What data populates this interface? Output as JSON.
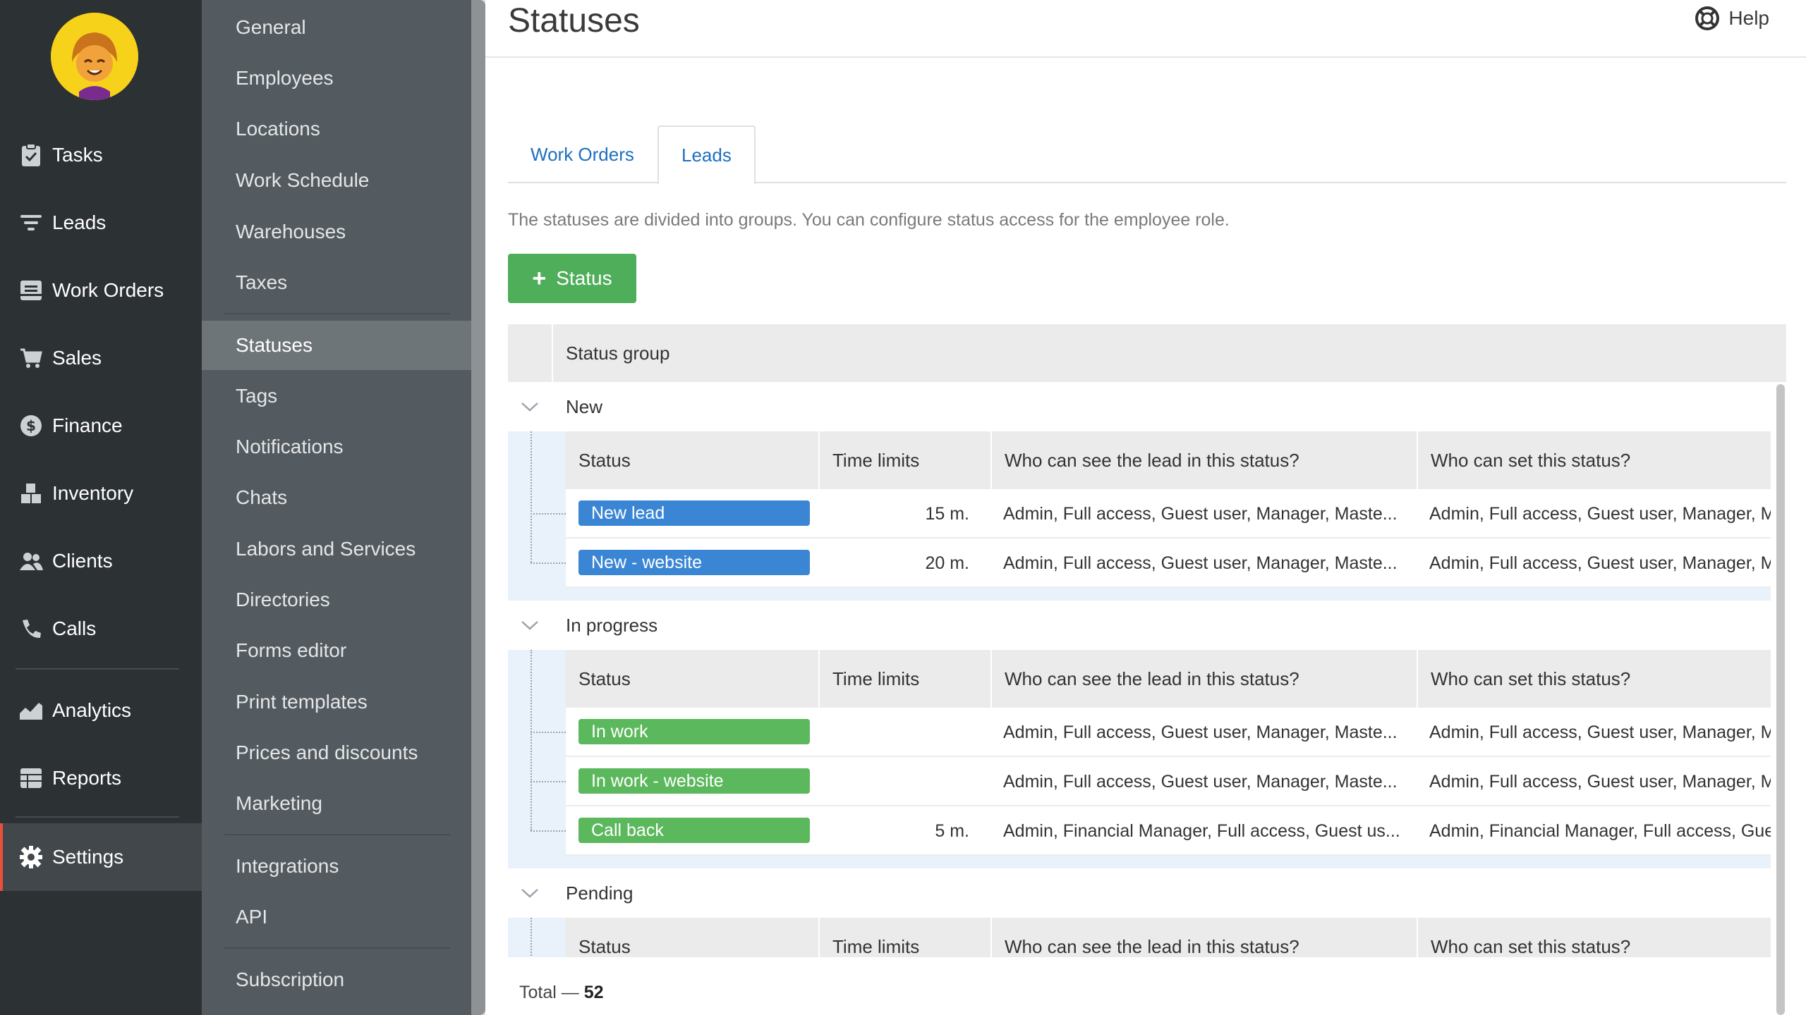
{
  "nav": {
    "items": [
      {
        "label": "Tasks",
        "icon": "clipboard-icon"
      },
      {
        "label": "Leads",
        "icon": "funnel-icon"
      },
      {
        "label": "Work Orders",
        "icon": "work-order-icon"
      },
      {
        "label": "Sales",
        "icon": "cart-icon"
      },
      {
        "label": "Finance",
        "icon": "dollar-icon"
      },
      {
        "label": "Inventory",
        "icon": "boxes-icon"
      },
      {
        "label": "Clients",
        "icon": "users-icon"
      },
      {
        "label": "Calls",
        "icon": "phone-icon"
      },
      {
        "label": "Analytics",
        "icon": "chart-icon"
      },
      {
        "label": "Reports",
        "icon": "report-icon"
      },
      {
        "label": "Settings",
        "icon": "gear-icon"
      }
    ]
  },
  "settings_menu": {
    "items": [
      "General",
      "Employees",
      "Locations",
      "Work Schedule",
      "Warehouses",
      "Taxes",
      "Statuses",
      "Tags",
      "Notifications",
      "Chats",
      "Labors and Services",
      "Directories",
      "Forms editor",
      "Print templates",
      "Prices and discounts",
      "Marketing",
      "Integrations",
      "API",
      "Subscription"
    ],
    "active": "Statuses"
  },
  "header": {
    "title": "Statuses",
    "help_label": "Help"
  },
  "tabs": [
    {
      "label": "Work Orders",
      "active": false
    },
    {
      "label": "Leads",
      "active": true
    }
  ],
  "description": "The statuses are divided into groups. You can configure status access for the employee role.",
  "add_button_label": "Status",
  "table": {
    "header": "Status group",
    "columns": [
      "Status",
      "Time limits",
      "Who can see the lead in this status?",
      "Who can set this status?"
    ],
    "groups": [
      {
        "name": "New",
        "statuses": [
          {
            "name": "New lead",
            "color": "#3b86d4",
            "time": "15 m.",
            "see": "Admin,  Full access,  Guest user,  Manager,  Maste...",
            "set": "Admin,  Full access,  Guest user,  Manager,  M"
          },
          {
            "name": "New - website",
            "color": "#3b86d4",
            "time": "20 m.",
            "see": "Admin,  Full access,  Guest user,  Manager,  Maste...",
            "set": "Admin,  Full access,  Guest user,  Manager,  M"
          }
        ]
      },
      {
        "name": "In progress",
        "statuses": [
          {
            "name": "In work",
            "color": "#5cb85c",
            "time": "",
            "see": "Admin,  Full access,  Guest user,  Manager,  Maste...",
            "set": "Admin,  Full access,  Guest user,  Manager,  M"
          },
          {
            "name": "In work - website",
            "color": "#5cb85c",
            "time": "",
            "see": "Admin,  Full access,  Guest user,  Manager,  Maste...",
            "set": "Admin,  Full access,  Guest user,  Manager,  M"
          },
          {
            "name": "Call back",
            "color": "#5cb85c",
            "time": "5 m.",
            "see": "Admin,  Financial Manager,  Full access,  Guest us...",
            "set": "Admin,  Financial Manager,  Full access,  Gue"
          }
        ]
      },
      {
        "name": "Pending",
        "statuses": []
      }
    ]
  },
  "total": {
    "label": "Total —",
    "count": "52"
  }
}
